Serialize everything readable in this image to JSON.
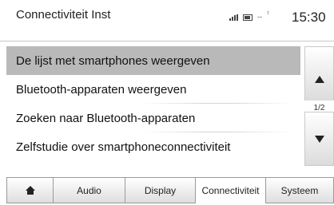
{
  "header": {
    "title": "Connectiviteit Inst",
    "status_dashes": "--",
    "status_mark": "ᵀ",
    "clock": "15:30",
    "icons": [
      "signal-icon",
      "battery-icon"
    ]
  },
  "menu": {
    "items": [
      {
        "label": "De lijst met smartphones weergeven",
        "selected": true
      },
      {
        "label": "Bluetooth-apparaten weergeven",
        "selected": false
      },
      {
        "label": "Zoeken naar Bluetooth-apparaten",
        "selected": false
      },
      {
        "label": "Zelfstudie over smartphoneconnectiviteit",
        "selected": false
      }
    ],
    "selected_color": "#b9b9b9"
  },
  "scroll": {
    "page": "1/2",
    "icons": [
      "arrow-up-icon",
      "arrow-down-icon"
    ]
  },
  "tabs": {
    "items": [
      {
        "icon": "home-icon",
        "label": ""
      },
      {
        "label": "Audio"
      },
      {
        "label": "Display"
      },
      {
        "label": "Connectiviteit",
        "active": true
      },
      {
        "label": "Systeem"
      }
    ]
  }
}
